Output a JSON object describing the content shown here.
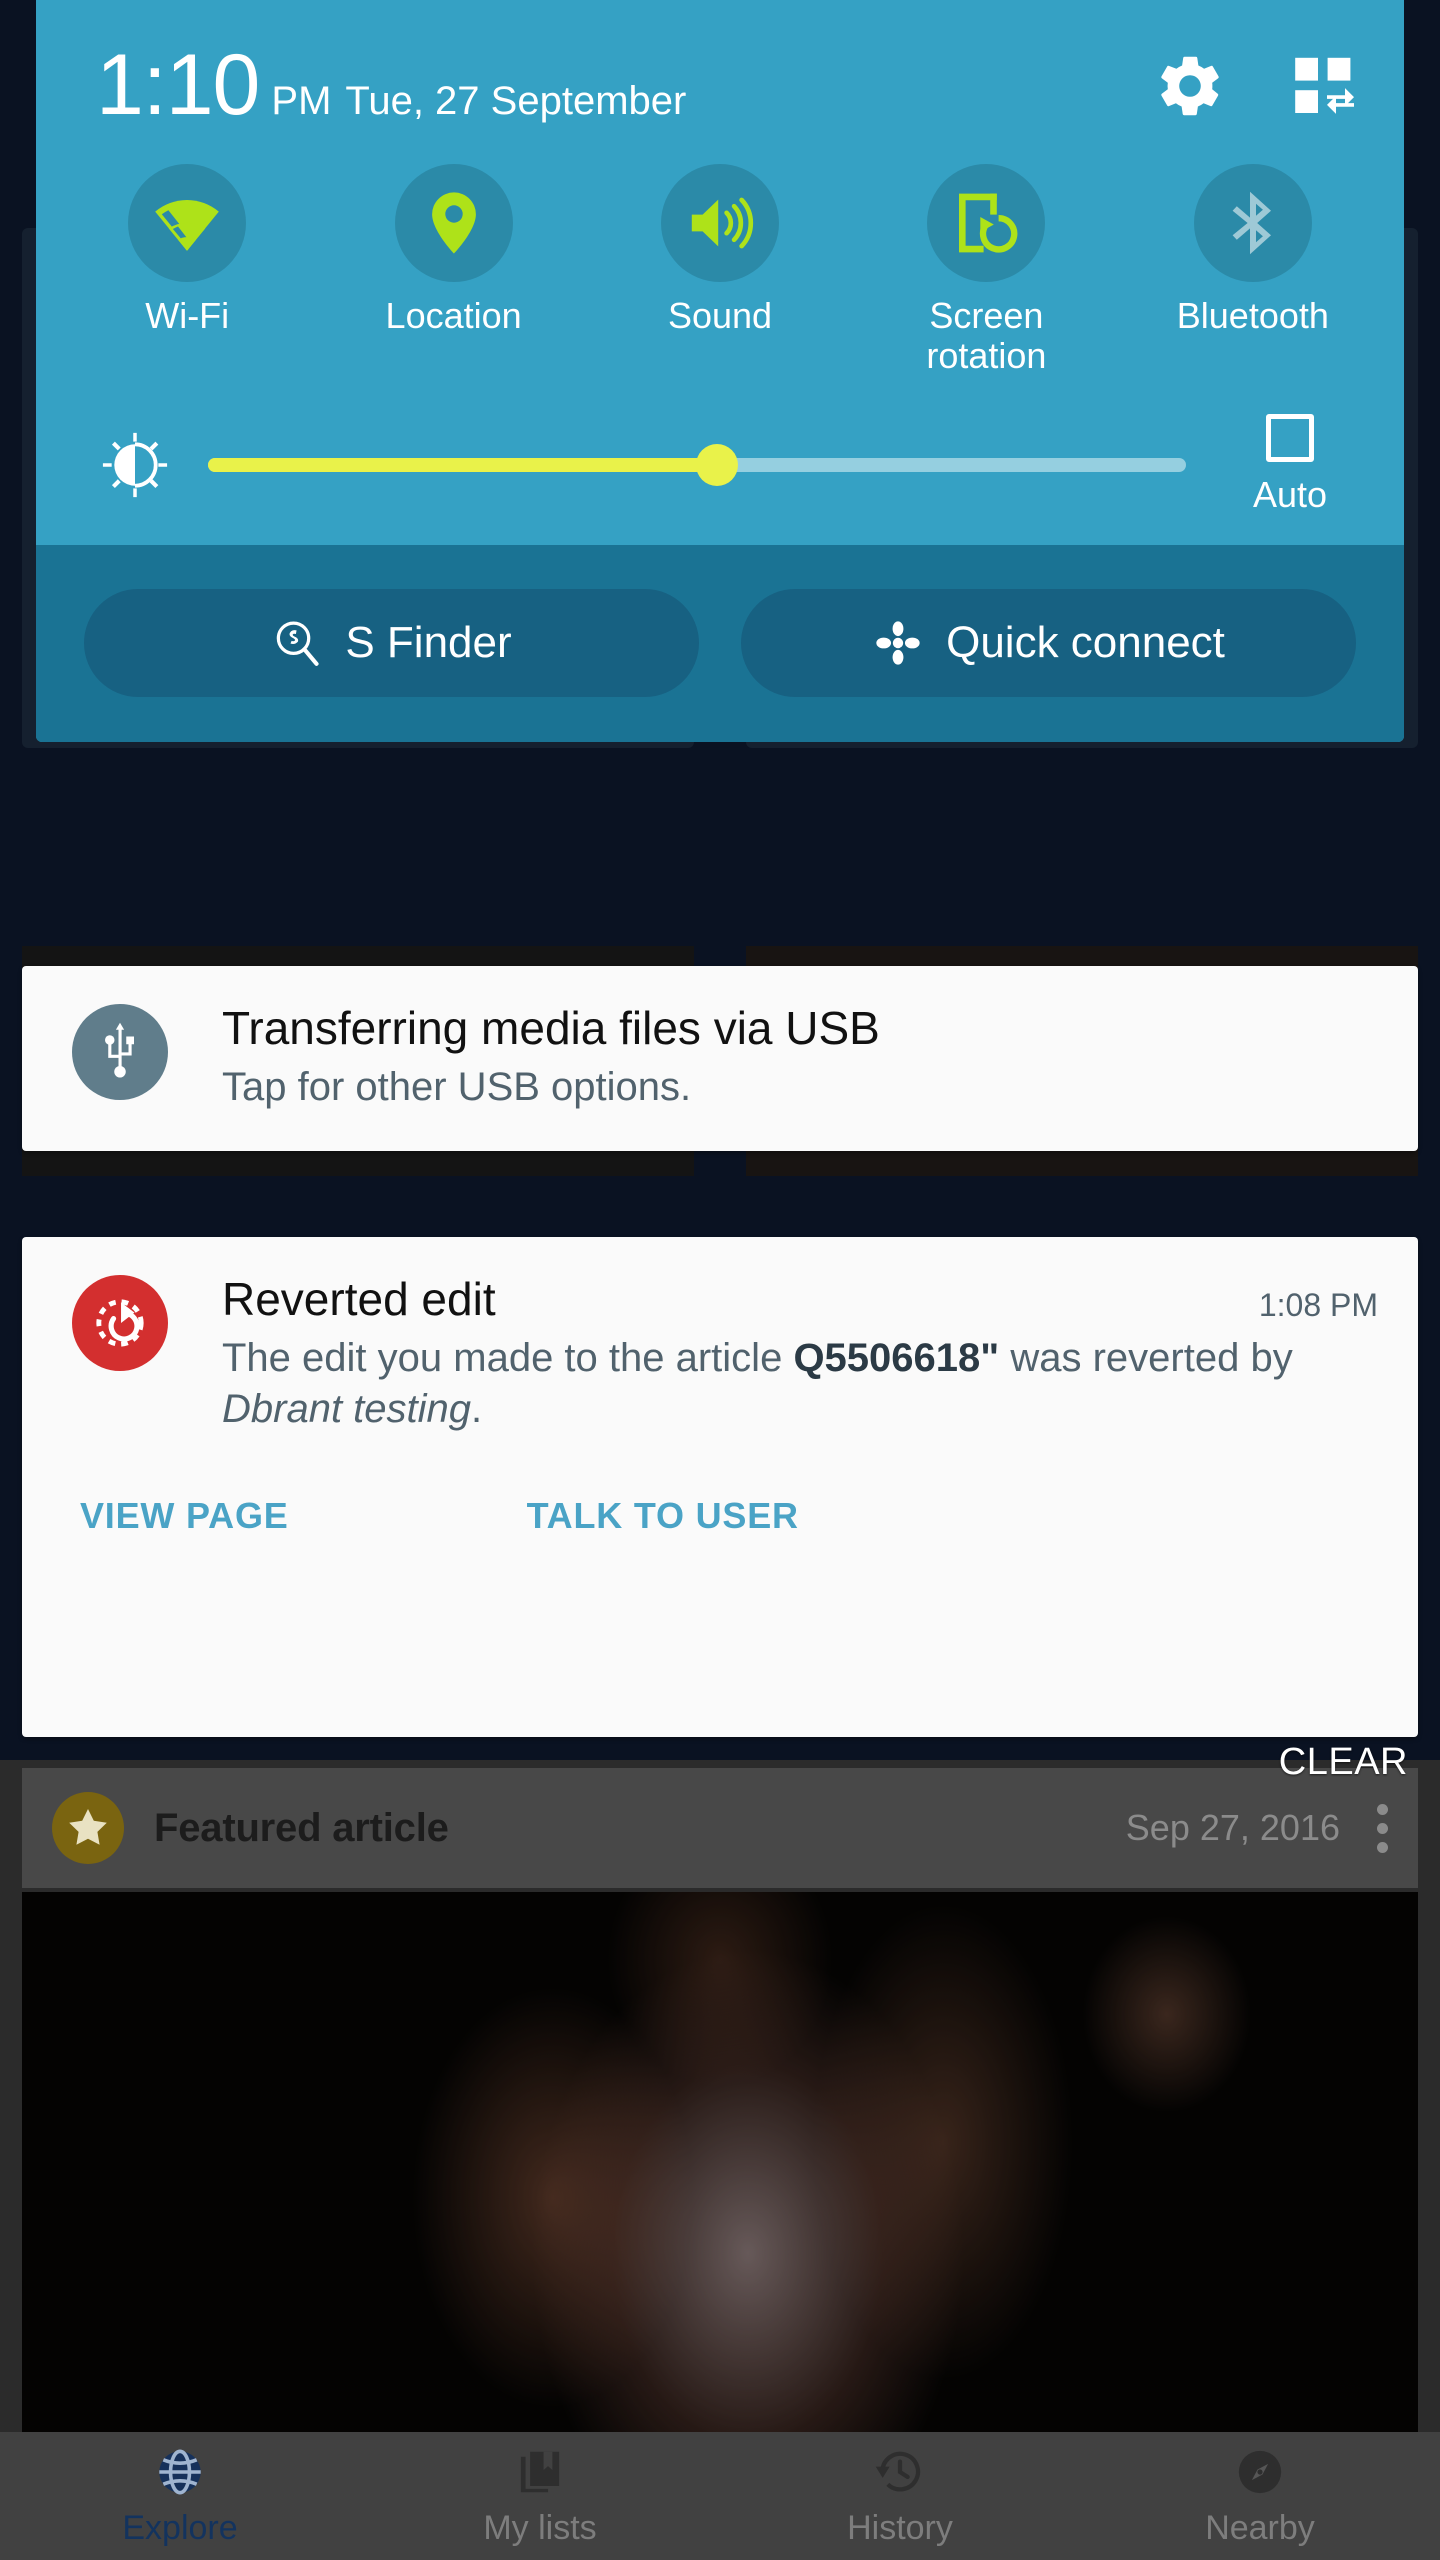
{
  "statusbar": {
    "time": "1:10",
    "ampm": "PM",
    "date": "Tue, 27 September",
    "settings_icon": "gear-icon",
    "edit_icon": "edit-quick-settings-icon"
  },
  "quick_settings": {
    "toggles": [
      {
        "label": "Wi-Fi",
        "icon": "wifi-icon",
        "state": "on"
      },
      {
        "label": "Location",
        "icon": "location-pin-icon",
        "state": "on"
      },
      {
        "label": "Sound",
        "icon": "sound-speaker-icon",
        "state": "on"
      },
      {
        "label": "Screen\nrotation",
        "icon": "screen-rotation-icon",
        "state": "on"
      },
      {
        "label": "Bluetooth",
        "icon": "bluetooth-icon",
        "state": "off"
      }
    ],
    "toggle_labels": {
      "wifi": "Wi-Fi",
      "location": "Location",
      "sound": "Sound",
      "screen_rotation_line1": "Screen",
      "screen_rotation_line2": "rotation",
      "bluetooth": "Bluetooth"
    },
    "brightness": {
      "icon": "brightness-icon",
      "value_percent": 52,
      "auto_label": "Auto",
      "auto_checked": false
    },
    "shortcuts": [
      {
        "label": "S Finder",
        "icon": "s-finder-icon"
      },
      {
        "label": "Quick connect",
        "icon": "quick-connect-icon"
      }
    ],
    "shortcut_labels": {
      "s_finder": "S Finder",
      "quick_connect": "Quick connect"
    },
    "colors": {
      "panel_bg": "#35a1c4",
      "toggle_circle": "#2b8aa8",
      "accent_on": "#aee219",
      "accent_off": "#9ec9d6",
      "slider_fill": "#e9f24a",
      "slider_track": "#95cfe0",
      "footer_bg": "#1a7394",
      "pill_bg": "#176182"
    }
  },
  "notifications": {
    "clear_label": "CLEAR",
    "items": [
      {
        "id": "usb",
        "icon": "usb-icon",
        "icon_bg": "#607d8b",
        "title": "Transferring media files via USB",
        "subtitle": "Tap for other USB options.",
        "time": ""
      },
      {
        "id": "reverted-edit",
        "icon": "revert-undo-icon",
        "icon_bg": "#d32f2f",
        "title": "Reverted edit",
        "time": "1:08 PM",
        "body_prefix": "The edit you made to the article ",
        "body_article": "Q5506618\"",
        "body_middle": " was reverted by ",
        "body_user": "Dbrant testing",
        "body_suffix": ".",
        "actions": [
          {
            "label": "VIEW PAGE"
          },
          {
            "label": "TALK TO USER"
          }
        ],
        "action_labels": {
          "view_page": "VIEW PAGE",
          "talk_to_user": "TALK TO USER"
        }
      }
    ]
  },
  "background_app": {
    "featured_row": {
      "icon": "star-icon",
      "title": "Featured article",
      "date": "Sep 27, 2016",
      "overflow_icon": "kebab-menu-icon"
    },
    "bottom_nav": [
      {
        "label": "Explore",
        "icon": "globe-icon",
        "active": true
      },
      {
        "label": "My lists",
        "icon": "bookmark-icon",
        "active": false
      },
      {
        "label": "History",
        "icon": "history-icon",
        "active": false
      },
      {
        "label": "Nearby",
        "icon": "compass-icon",
        "active": false
      }
    ],
    "nav_labels": {
      "explore": "Explore",
      "my_lists": "My lists",
      "history": "History",
      "nearby": "Nearby"
    }
  }
}
